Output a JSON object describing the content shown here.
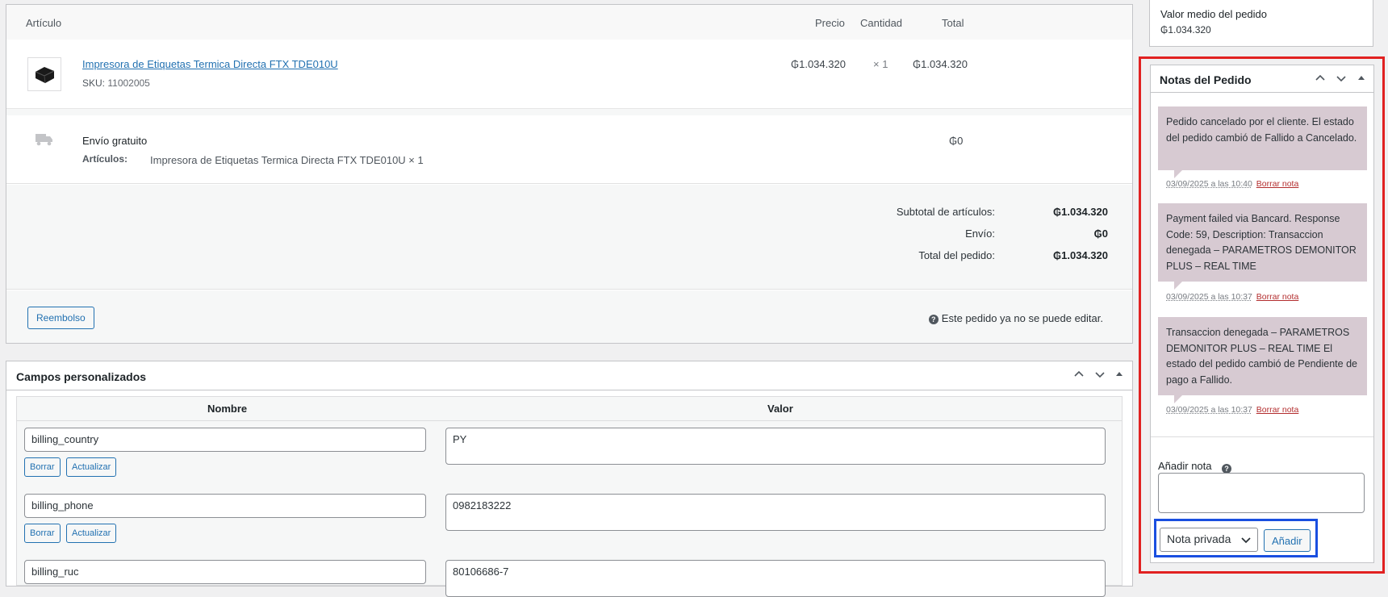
{
  "items_panel": {
    "headers": {
      "article": "Artículo",
      "price": "Precio",
      "qty": "Cantidad",
      "total": "Total"
    },
    "item": {
      "name": "Impresora de Etiquetas Termica Directa FTX TDE010U",
      "sku_label": "SKU:",
      "sku": "11002005",
      "price": "₲1.034.320",
      "qty": "× 1",
      "total": "₲1.034.320"
    },
    "shipping": {
      "name": "Envío gratuito",
      "meta_label": "Artículos:",
      "meta_value": "Impresora de Etiquetas Termica Directa FTX TDE010U × 1",
      "total": "₲0"
    },
    "totals": {
      "subtotal_label": "Subtotal de artículos:",
      "subtotal": "₲1.034.320",
      "shipping_label": "Envío:",
      "shipping": "₲0",
      "order_total_label": "Total del pedido:",
      "order_total": "₲1.034.320"
    },
    "refund_button": "Reembolso",
    "no_edit_notice": "Este pedido ya no se puede editar."
  },
  "custom_fields": {
    "title": "Campos personalizados",
    "col_name": "Nombre",
    "col_value": "Valor",
    "delete_label": "Borrar",
    "update_label": "Actualizar",
    "rows": [
      {
        "key": "billing_country",
        "value": "PY"
      },
      {
        "key": "billing_phone",
        "value": "0982183222"
      },
      {
        "key": "billing_ruc",
        "value": "80106686-7"
      }
    ]
  },
  "aov": {
    "label": "Valor medio del pedido",
    "value": "₲1.034.320"
  },
  "notes": {
    "title": "Notas del Pedido",
    "delete_link": "Borrar nota",
    "list": [
      {
        "text": "Pedido cancelado por el cliente. El estado del pedido cambió de Fallido a Cancelado.",
        "date": "03/09/2025 a las 10:40"
      },
      {
        "text": "Payment failed via Bancard. Response Code: 59, Description: Transaccion denegada – PARAMETROS DEMONITOR PLUS – REAL TIME",
        "date": "03/09/2025 a las 10:37"
      },
      {
        "text": "Transaccion denegada – PARAMETROS DEMONITOR PLUS – REAL TIME El estado del pedido cambió de Pendiente de pago a Fallido.",
        "date": "03/09/2025 a las 10:37"
      }
    ],
    "add_label": "Añadir nota",
    "note_type_selected": "Nota privada",
    "add_button": "Añadir"
  },
  "colors": {
    "note_bg": "#d7cad2",
    "accent": "#2271b1",
    "red_highlight": "#e12121",
    "blue_highlight": "#1a4fe0"
  }
}
